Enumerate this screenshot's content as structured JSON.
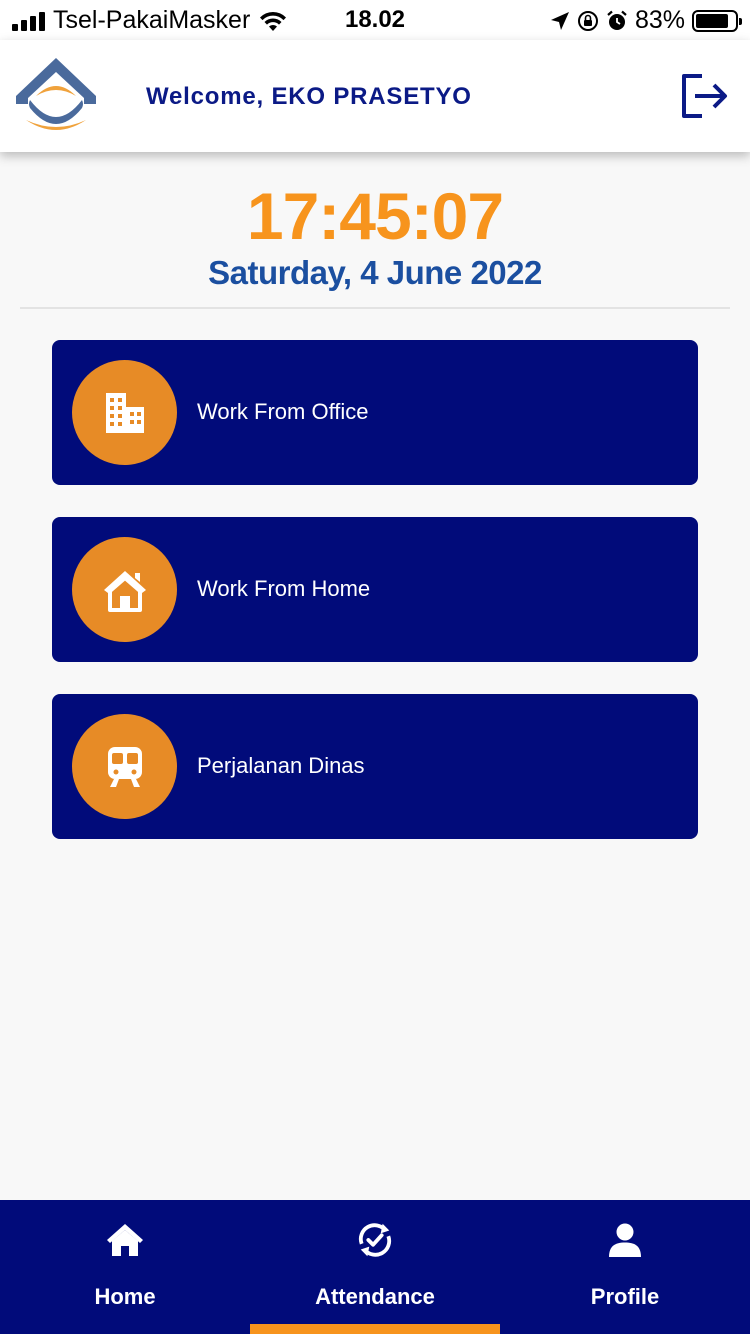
{
  "status_bar": {
    "carrier": "Tsel-PakaiMasker",
    "time": "18.02",
    "battery": "83%",
    "battery_level": 0.83
  },
  "header": {
    "welcome": "Welcome, EKO PRASETYO",
    "logo_icon": "company-logo",
    "logout_icon": "logout-icon"
  },
  "clock": {
    "time": "17:45:07",
    "date": "Saturday, 4 June 2022"
  },
  "options": [
    {
      "label": "Work From Office",
      "icon": "building-icon"
    },
    {
      "label": "Work From Home",
      "icon": "home-icon"
    },
    {
      "label": "Perjalanan Dinas",
      "icon": "train-icon"
    }
  ],
  "nav": {
    "items": [
      {
        "label": "Home",
        "icon": "home-icon"
      },
      {
        "label": "Attendance",
        "icon": "attendance-icon"
      },
      {
        "label": "Profile",
        "icon": "user-icon"
      }
    ],
    "active": "Attendance"
  },
  "colors": {
    "accent": "#f7941d",
    "primary": "#010b7a",
    "date": "#1b4fa0",
    "icon_bg": "#e78b26"
  }
}
